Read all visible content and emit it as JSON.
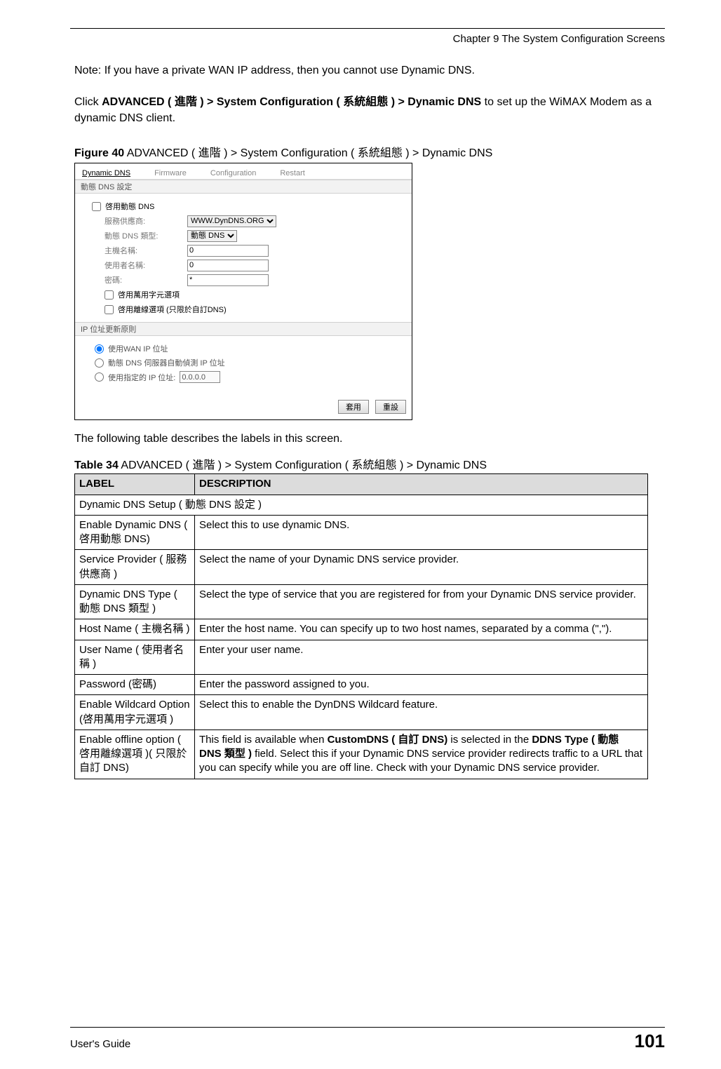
{
  "header": {
    "chapter": "Chapter 9 The System Configuration Screens"
  },
  "body": {
    "note": "Note: If you have a private WAN IP address, then you cannot use Dynamic DNS.",
    "click_pre": "Click ",
    "click_bold": "ADVANCED ( 進階 ) > System Configuration ( 系統組態 ) > Dynamic DNS",
    "click_post": " to set up the WiMAX Modem as a dynamic DNS client.",
    "fig_label": "Figure 40",
    "fig_title": "   ADVANCED ( 進階 ) > System Configuration ( 系統組態 ) > Dynamic DNS",
    "after_fig": "The following table describes the labels in this screen.",
    "tbl_label": "Table 34",
    "tbl_title": "   ADVANCED ( 進階 ) > System Configuration ( 系統組態 ) > Dynamic DNS"
  },
  "screenshot": {
    "tabs": [
      "Dynamic DNS",
      "Firmware",
      "Configuration",
      "Restart"
    ],
    "group1": "動態 DNS 設定",
    "chk_enable": "啓用動態 DNS",
    "lbl_provider": "服務供應商:",
    "sel_provider": "WWW.DynDNS.ORG",
    "lbl_type": "動態 DNS 類型:",
    "sel_type": "動態 DNS",
    "lbl_host": "主機名稱:",
    "val_host": "0",
    "lbl_user": "使用者名稱:",
    "val_user": "0",
    "lbl_pass": "密碼:",
    "val_pass": "*",
    "chk_wildcard": "啓用萬用字元選項",
    "chk_offline": "啓用離線選項 (只限於自訂DNS)",
    "group2": "IP 位址更新原則",
    "radio1": "使用WAN IP 位址",
    "radio2": "動態 DNS 伺服器自動偵測 IP 位址",
    "radio3_pre": "使用指定的 IP 位址:",
    "radio3_val": "0.0.0.0",
    "btn_apply": "套用",
    "btn_reset": "重設"
  },
  "table": {
    "h_label": "LABEL",
    "h_desc": "DESCRIPTION",
    "section1": "Dynamic DNS Setup ( 動態 DNS 設定 )",
    "rows": [
      {
        "l": "Enable Dynamic DNS ( 啓用動態 DNS)",
        "d": "Select this to use dynamic DNS."
      },
      {
        "l": "Service Provider ( 服務供應商 )",
        "d": "Select the name of your Dynamic DNS service provider."
      },
      {
        "l": "Dynamic DNS Type ( 動態 DNS 類型 )",
        "d": "Select the type of service that you are registered for from your Dynamic DNS service provider."
      },
      {
        "l": "Host Name ( 主機名稱 )",
        "d": "Enter the host name. You can specify up to two host names, separated by a comma (\",\")."
      },
      {
        "l": "User Name ( 使用者名稱 )",
        "d": "Enter your user name."
      },
      {
        "l": "Password (密碼)",
        "d": "Enter the password assigned to you."
      },
      {
        "l": "Enable Wildcard Option (啓用萬用字元選項 )",
        "d": "Select this to enable the DynDNS Wildcard feature."
      }
    ],
    "last_row": {
      "l": "Enable offline option ( 啓用離線選項 )( 只限於自訂 DNS)",
      "d_pre": "This field is available when ",
      "d_b1": "CustomDNS ( 自訂 DNS)",
      "d_mid": " is selected in the ",
      "d_b2": "DDNS Type ( 動態 DNS 類型 )",
      "d_post": " field. Select this if your Dynamic DNS service provider redirects traffic to a URL that you can specify while you are off line. Check with your Dynamic DNS service provider."
    }
  },
  "footer": {
    "left": "User's Guide",
    "right": "101"
  }
}
